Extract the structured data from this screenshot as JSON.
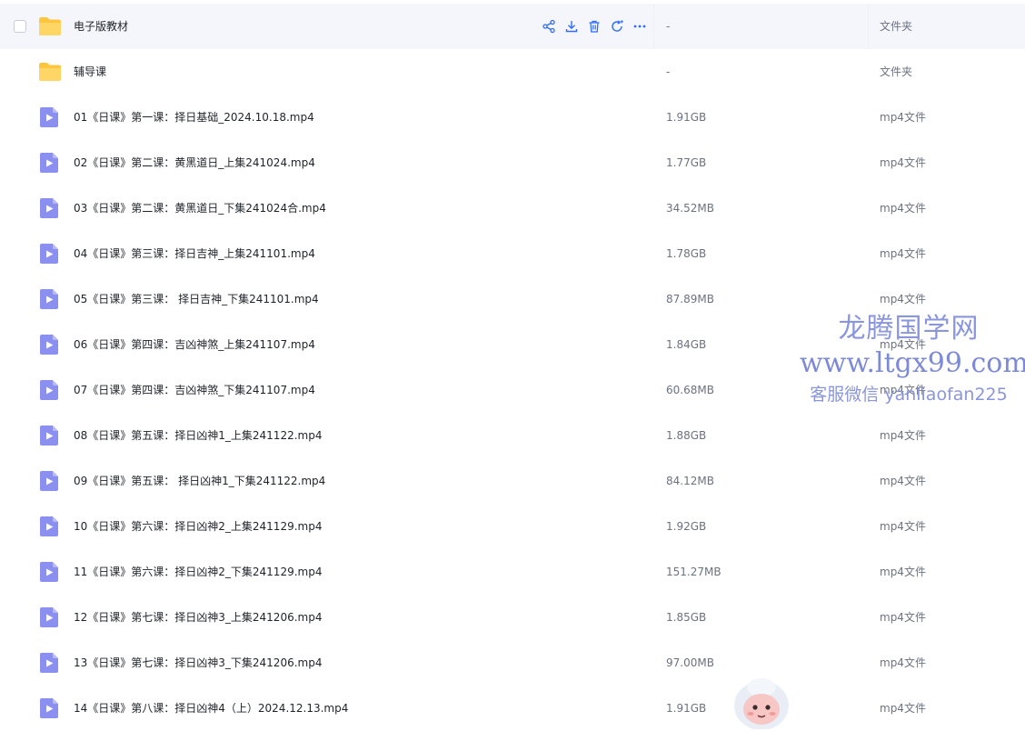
{
  "file_list": {
    "rows": [
      {
        "name": "电子版教材",
        "size": "-",
        "type": "文件夹",
        "kind": "folder",
        "hover": true
      },
      {
        "name": "辅导课",
        "size": "-",
        "type": "文件夹",
        "kind": "folder"
      },
      {
        "name": "01《日课》第一课：择日基础_2024.10.18.mp4",
        "size": "1.91GB",
        "type": "mp4文件",
        "kind": "video"
      },
      {
        "name": "02《日课》第二课：黄黑道日_上集241024.mp4",
        "size": "1.77GB",
        "type": "mp4文件",
        "kind": "video"
      },
      {
        "name": "03《日课》第二课：黄黑道日_下集241024合.mp4",
        "size": "34.52MB",
        "type": "mp4文件",
        "kind": "video"
      },
      {
        "name": "04《日课》第三课：择日吉神_上集241101.mp4",
        "size": "1.78GB",
        "type": "mp4文件",
        "kind": "video"
      },
      {
        "name": "05《日课》第三课： 择日吉神_下集241101.mp4",
        "size": "87.89MB",
        "type": "mp4文件",
        "kind": "video"
      },
      {
        "name": "06《日课》第四课：吉凶神煞_上集241107.mp4",
        "size": "1.84GB",
        "type": "mp4文件",
        "kind": "video"
      },
      {
        "name": "07《日课》第四课：吉凶神煞_下集241107.mp4",
        "size": "60.68MB",
        "type": "mp4文件",
        "kind": "video"
      },
      {
        "name": "08《日课》第五课：择日凶神1_上集241122.mp4",
        "size": "1.88GB",
        "type": "mp4文件",
        "kind": "video"
      },
      {
        "name": "09《日课》第五课： 择日凶神1_下集241122.mp4",
        "size": "84.12MB",
        "type": "mp4文件",
        "kind": "video"
      },
      {
        "name": "10《日课》第六课：择日凶神2_上集241129.mp4",
        "size": "1.92GB",
        "type": "mp4文件",
        "kind": "video"
      },
      {
        "name": "11《日课》第六课：择日凶神2_下集241129.mp4",
        "size": "151.27MB",
        "type": "mp4文件",
        "kind": "video"
      },
      {
        "name": "12《日课》第七课：择日凶神3_上集241206.mp4",
        "size": "1.85GB",
        "type": "mp4文件",
        "kind": "video"
      },
      {
        "name": "13《日课》第七课：择日凶神3_下集241206.mp4",
        "size": "97.00MB",
        "type": "mp4文件",
        "kind": "video"
      },
      {
        "name": "14《日课》第八课：择日凶神4（上）2024.12.13.mp4",
        "size": "1.91GB",
        "type": "mp4文件",
        "kind": "video"
      }
    ],
    "hover_actions": [
      "share-icon",
      "download-icon",
      "delete-icon",
      "sync-icon",
      "more-icon"
    ]
  },
  "watermark": {
    "line1": "龙腾国学网",
    "line2": "www.ltgx99.com",
    "line3": "客服微信 yanliaofan225"
  },
  "colors": {
    "folder": "#ffc53d",
    "video": "#8b8ff0",
    "accent": "#2f6bff",
    "hover_bg": "#f4f6fb"
  }
}
